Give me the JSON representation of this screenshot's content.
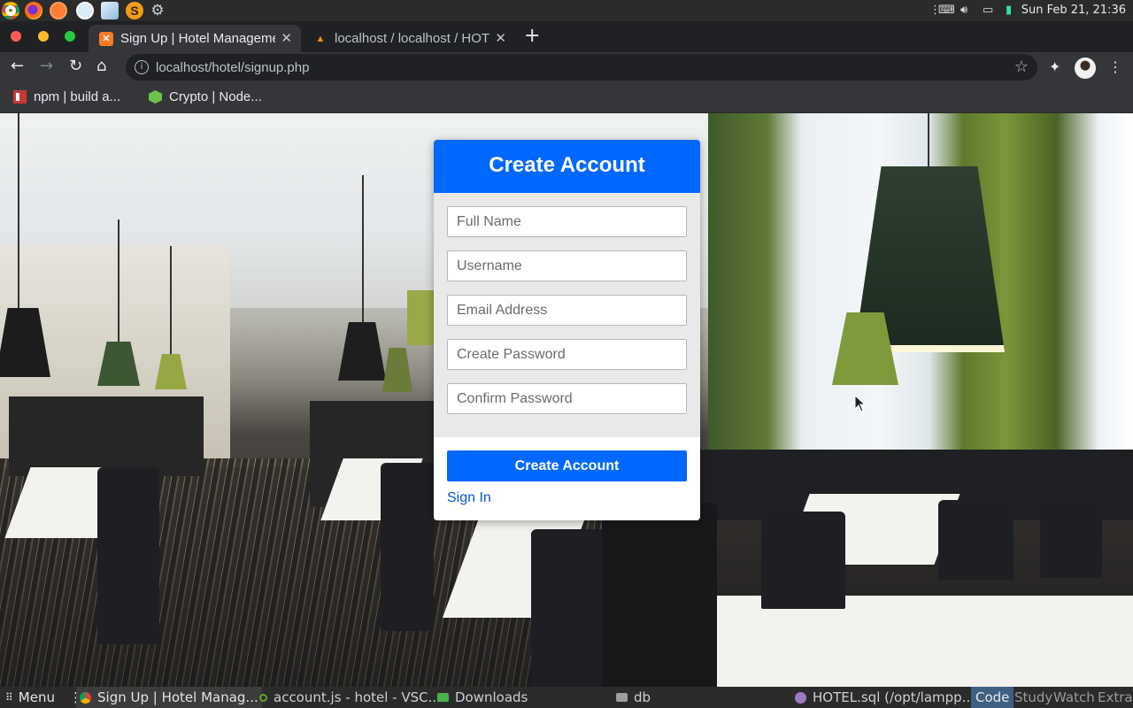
{
  "system": {
    "clock": "Sun Feb 21, 21:36",
    "launchers": [
      "chrome-icon",
      "firefox-icon",
      "safari-icon",
      "vscode-icon",
      "virtualbox-icon",
      "sublime-icon",
      "settings-icon"
    ]
  },
  "browser": {
    "tabs": [
      {
        "title": "Sign Up | Hotel Management",
        "active": true
      },
      {
        "title": "localhost / localhost / HOTEL",
        "active": false
      }
    ],
    "new_tab": "+",
    "address": "localhost/hotel/signup.php",
    "bookmarks": [
      {
        "label": "npm | build a..."
      },
      {
        "label": "Crypto | Node..."
      }
    ]
  },
  "form": {
    "title": "Create Account",
    "fields": [
      {
        "placeholder": "Full Name"
      },
      {
        "placeholder": "Username"
      },
      {
        "placeholder": "Email Address"
      },
      {
        "placeholder": "Create Password"
      },
      {
        "placeholder": "Confirm Password"
      }
    ],
    "submit_label": "Create Account",
    "signin_label": "Sign In"
  },
  "taskbar": {
    "menu_label": "Menu",
    "items": [
      {
        "label": "Sign Up | Hotel Manag..."
      },
      {
        "label": "account.js - hotel - VSC..."
      },
      {
        "label": "Downloads"
      },
      {
        "label": "db"
      },
      {
        "label": "HOTEL.sql (/opt/lampp..."
      }
    ],
    "workspaces": [
      "Code",
      "Study",
      "Watch",
      "Extra"
    ]
  },
  "colors": {
    "primary": "#0068ff",
    "link": "#0a58ca",
    "card_body": "#e9e9e9"
  }
}
